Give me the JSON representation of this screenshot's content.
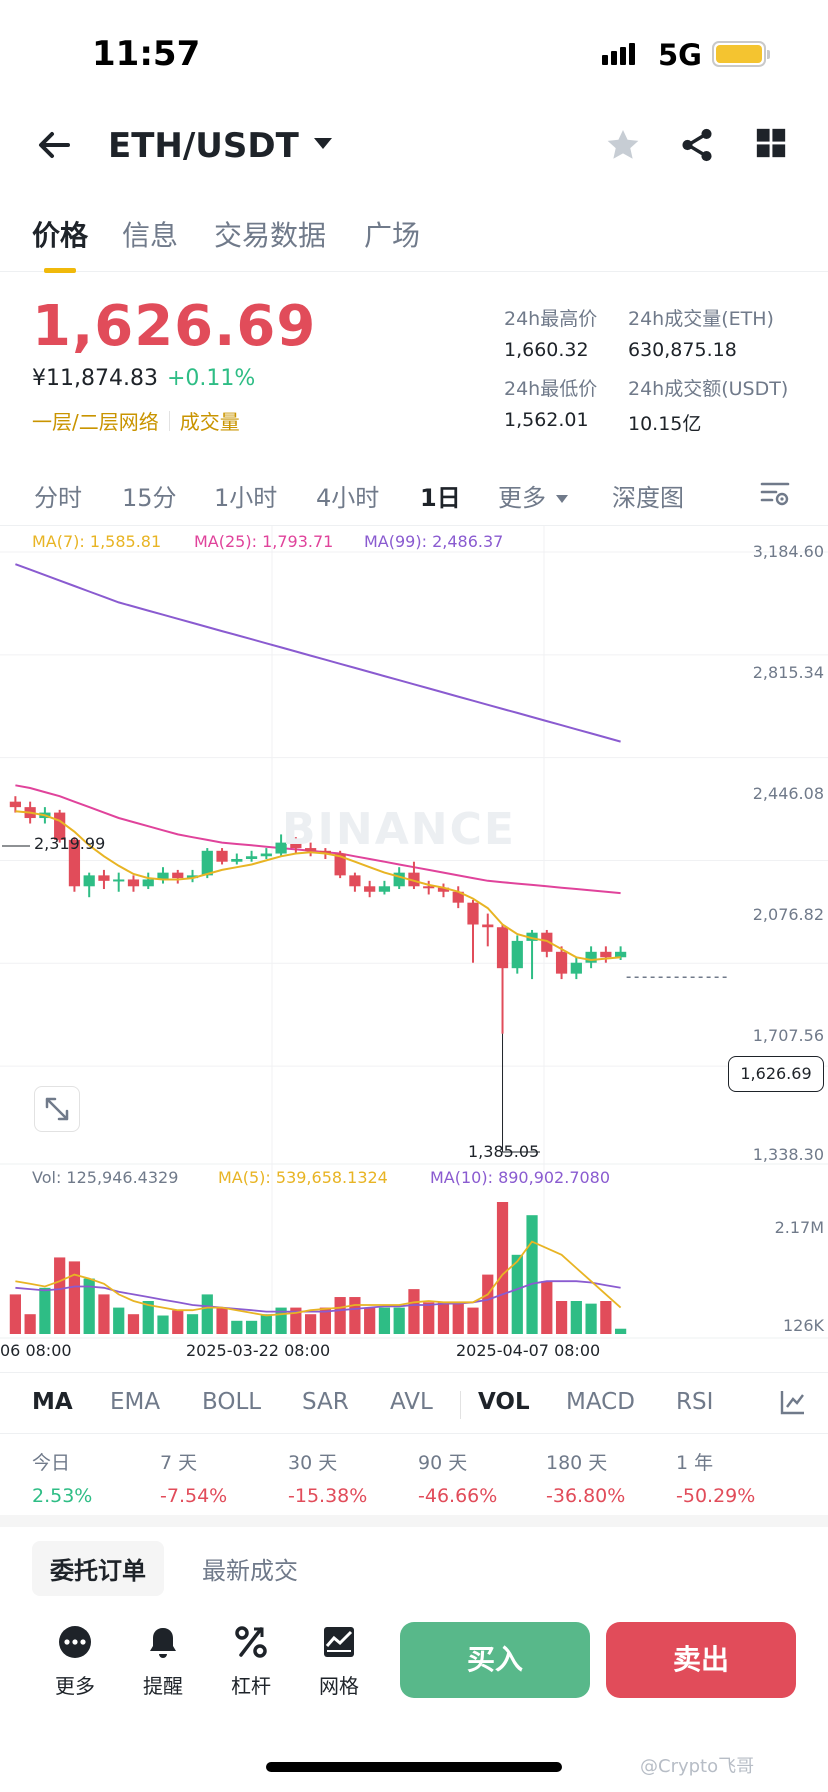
{
  "status": {
    "time": "11:57",
    "network": "5G"
  },
  "header": {
    "pair": "ETH/USDT"
  },
  "tabs": [
    "价格",
    "信息",
    "交易数据",
    "广场"
  ],
  "price": {
    "last": "1,626.69",
    "cny": "¥11,874.83",
    "change_pct": "+0.11%",
    "tag_network": "一层/二层网络",
    "tag_volume": "成交量",
    "high_label": "24h最高价",
    "high": "1,660.32",
    "low_label": "24h最低价",
    "low": "1,562.01",
    "vol_eth_label": "24h成交量(ETH)",
    "vol_eth": "630,875.18",
    "vol_usdt_label": "24h成交额(USDT)",
    "vol_usdt": "10.15亿"
  },
  "periods": [
    "分时",
    "15分",
    "1小时",
    "4小时",
    "1日",
    "更多",
    "深度图"
  ],
  "chart": {
    "ma7": "MA(7): 1,585.81",
    "ma25": "MA(25): 1,793.71",
    "ma99": "MA(99): 2,486.37",
    "watermark": "BINANCE",
    "axis": [
      "3,184.60",
      "2,815.34",
      "2,446.08",
      "2,076.82",
      "1,707.56",
      "1,338.30"
    ],
    "current": "1,626.69",
    "high_mark": "2,319.99",
    "low_mark": "1,385.05",
    "vol_label": "Vol: 125,946.4329",
    "vol_ma5": "MA(5): 539,658.1324",
    "vol_ma10": "MA(10): 890,902.7080",
    "vol_axis_top": "2.17M",
    "vol_axis_bottom": "126K",
    "dates": [
      "06 08:00",
      "2025-03-22 08:00",
      "2025-04-07 08:00"
    ],
    "colors": {
      "up": "#2ebd85",
      "down": "#e14c5a",
      "ma7": "#e8b424",
      "ma25": "#e0439b",
      "ma99": "#8a5bd0"
    }
  },
  "indicators": [
    "MA",
    "EMA",
    "BOLL",
    "SAR",
    "AVL",
    "VOL",
    "MACD",
    "RSI"
  ],
  "performance": [
    {
      "label": "今日",
      "value": "2.53%"
    },
    {
      "label": "7 天",
      "value": "-7.54%"
    },
    {
      "label": "30 天",
      "value": "-15.38%"
    },
    {
      "label": "90 天",
      "value": "-46.66%"
    },
    {
      "label": "180 天",
      "value": "-36.80%"
    },
    {
      "label": "1 年",
      "value": "-50.29%"
    }
  ],
  "orders": {
    "tab_orders": "委托订单",
    "tab_trades": "最新成交"
  },
  "actions": {
    "more": "更多",
    "alert": "提醒",
    "leverage": "杠杆",
    "grid": "网格",
    "buy": "买入",
    "sell": "卖出"
  },
  "corner_watermark": "@Crypto飞哥",
  "chart_data": {
    "type": "candlestick",
    "ylim": [
      1338.3,
      3184.6
    ],
    "candles": [
      [
        2270,
        2250,
        2290,
        2230
      ],
      [
        2250,
        2210,
        2270,
        2190
      ],
      [
        2210,
        2230,
        2250,
        2190
      ],
      [
        2230,
        2130,
        2240,
        2120
      ],
      [
        2130,
        1960,
        2140,
        1940
      ],
      [
        1960,
        2000,
        2010,
        1920
      ],
      [
        2000,
        1980,
        2020,
        1950
      ],
      [
        1980,
        1985,
        2010,
        1940
      ],
      [
        1985,
        1960,
        2000,
        1940
      ],
      [
        1960,
        1985,
        2010,
        1950
      ],
      [
        1985,
        2010,
        2030,
        1970
      ],
      [
        2010,
        1990,
        2020,
        1970
      ],
      [
        1990,
        2000,
        2020,
        1975
      ],
      [
        2000,
        2090,
        2100,
        1990
      ],
      [
        2090,
        2050,
        2100,
        2040
      ],
      [
        2050,
        2060,
        2080,
        2040
      ],
      [
        2060,
        2070,
        2090,
        2050
      ],
      [
        2070,
        2080,
        2100,
        2060
      ],
      [
        2080,
        2120,
        2150,
        2070
      ],
      [
        2120,
        2100,
        2140,
        2080
      ],
      [
        2100,
        2090,
        2120,
        2070
      ],
      [
        2090,
        2080,
        2100,
        2060
      ],
      [
        2080,
        2000,
        2090,
        1990
      ],
      [
        2000,
        1960,
        2010,
        1940
      ],
      [
        1960,
        1940,
        1980,
        1920
      ],
      [
        1940,
        1960,
        1980,
        1930
      ],
      [
        1960,
        2010,
        2030,
        1950
      ],
      [
        2010,
        1960,
        2050,
        1950
      ],
      [
        1960,
        1955,
        1980,
        1930
      ],
      [
        1955,
        1940,
        1970,
        1920
      ],
      [
        1940,
        1900,
        1960,
        1880
      ],
      [
        1900,
        1820,
        1910,
        1680
      ],
      [
        1820,
        1810,
        1860,
        1740
      ],
      [
        1810,
        1660,
        1820,
        1420
      ],
      [
        1660,
        1760,
        1780,
        1640
      ],
      [
        1760,
        1790,
        1800,
        1620
      ],
      [
        1790,
        1720,
        1800,
        1700
      ],
      [
        1720,
        1640,
        1740,
        1620
      ],
      [
        1640,
        1680,
        1700,
        1620
      ],
      [
        1680,
        1720,
        1740,
        1660
      ],
      [
        1720,
        1700,
        1740,
        1680
      ],
      [
        1700,
        1720,
        1740,
        1690
      ]
    ],
    "ma7": [
      2235,
      2230,
      2220,
      2200,
      2160,
      2110,
      2070,
      2035,
      2005,
      1990,
      1985,
      1985,
      1990,
      2005,
      2020,
      2030,
      2040,
      2055,
      2070,
      2080,
      2085,
      2080,
      2070,
      2050,
      2030,
      2010,
      1995,
      1980,
      1965,
      1955,
      1940,
      1915,
      1880,
      1820,
      1785,
      1770,
      1760,
      1730,
      1700,
      1690,
      1695,
      1700
    ],
    "ma25": [
      2330,
      2320,
      2305,
      2290,
      2270,
      2250,
      2230,
      2210,
      2195,
      2180,
      2165,
      2150,
      2140,
      2130,
      2120,
      2115,
      2110,
      2105,
      2100,
      2095,
      2090,
      2085,
      2080,
      2070,
      2060,
      2050,
      2040,
      2030,
      2020,
      2010,
      2000,
      1990,
      1980,
      1975,
      1970,
      1965,
      1960,
      1955,
      1950,
      1945,
      1940,
      1935
    ],
    "ma99": [
      3140,
      3120,
      3100,
      3080,
      3060,
      3040,
      3020,
      3000,
      2985,
      2970,
      2955,
      2940,
      2925,
      2910,
      2895,
      2880,
      2865,
      2850,
      2835,
      2820,
      2805,
      2790,
      2775,
      2760,
      2745,
      2730,
      2715,
      2700,
      2685,
      2670,
      2655,
      2640,
      2625,
      2610,
      2595,
      2580,
      2565,
      2550,
      2535,
      2520,
      2505,
      2490
    ],
    "volume": [
      0.3,
      0.15,
      0.35,
      0.58,
      0.55,
      0.42,
      0.3,
      0.2,
      0.15,
      0.25,
      0.14,
      0.18,
      0.15,
      0.3,
      0.2,
      0.1,
      0.1,
      0.15,
      0.2,
      0.2,
      0.15,
      0.2,
      0.28,
      0.28,
      0.2,
      0.2,
      0.2,
      0.34,
      0.24,
      0.24,
      0.24,
      0.2,
      0.45,
      1.0,
      0.6,
      0.9,
      0.4,
      0.25,
      0.25,
      0.23,
      0.25,
      0.04
    ],
    "vol_ma5": [
      0.4,
      0.38,
      0.36,
      0.4,
      0.45,
      0.42,
      0.38,
      0.3,
      0.25,
      0.22,
      0.2,
      0.18,
      0.18,
      0.2,
      0.2,
      0.18,
      0.16,
      0.14,
      0.15,
      0.16,
      0.18,
      0.19,
      0.2,
      0.22,
      0.22,
      0.22,
      0.22,
      0.24,
      0.25,
      0.24,
      0.24,
      0.24,
      0.3,
      0.45,
      0.55,
      0.7,
      0.65,
      0.6,
      0.5,
      0.4,
      0.3,
      0.2
    ],
    "vol_ma10": [
      0.35,
      0.34,
      0.33,
      0.34,
      0.36,
      0.36,
      0.35,
      0.32,
      0.3,
      0.28,
      0.26,
      0.24,
      0.22,
      0.21,
      0.2,
      0.19,
      0.18,
      0.17,
      0.17,
      0.17,
      0.17,
      0.17,
      0.18,
      0.19,
      0.2,
      0.21,
      0.21,
      0.22,
      0.22,
      0.23,
      0.23,
      0.24,
      0.26,
      0.3,
      0.34,
      0.38,
      0.4,
      0.4,
      0.4,
      0.39,
      0.37,
      0.35
    ]
  }
}
